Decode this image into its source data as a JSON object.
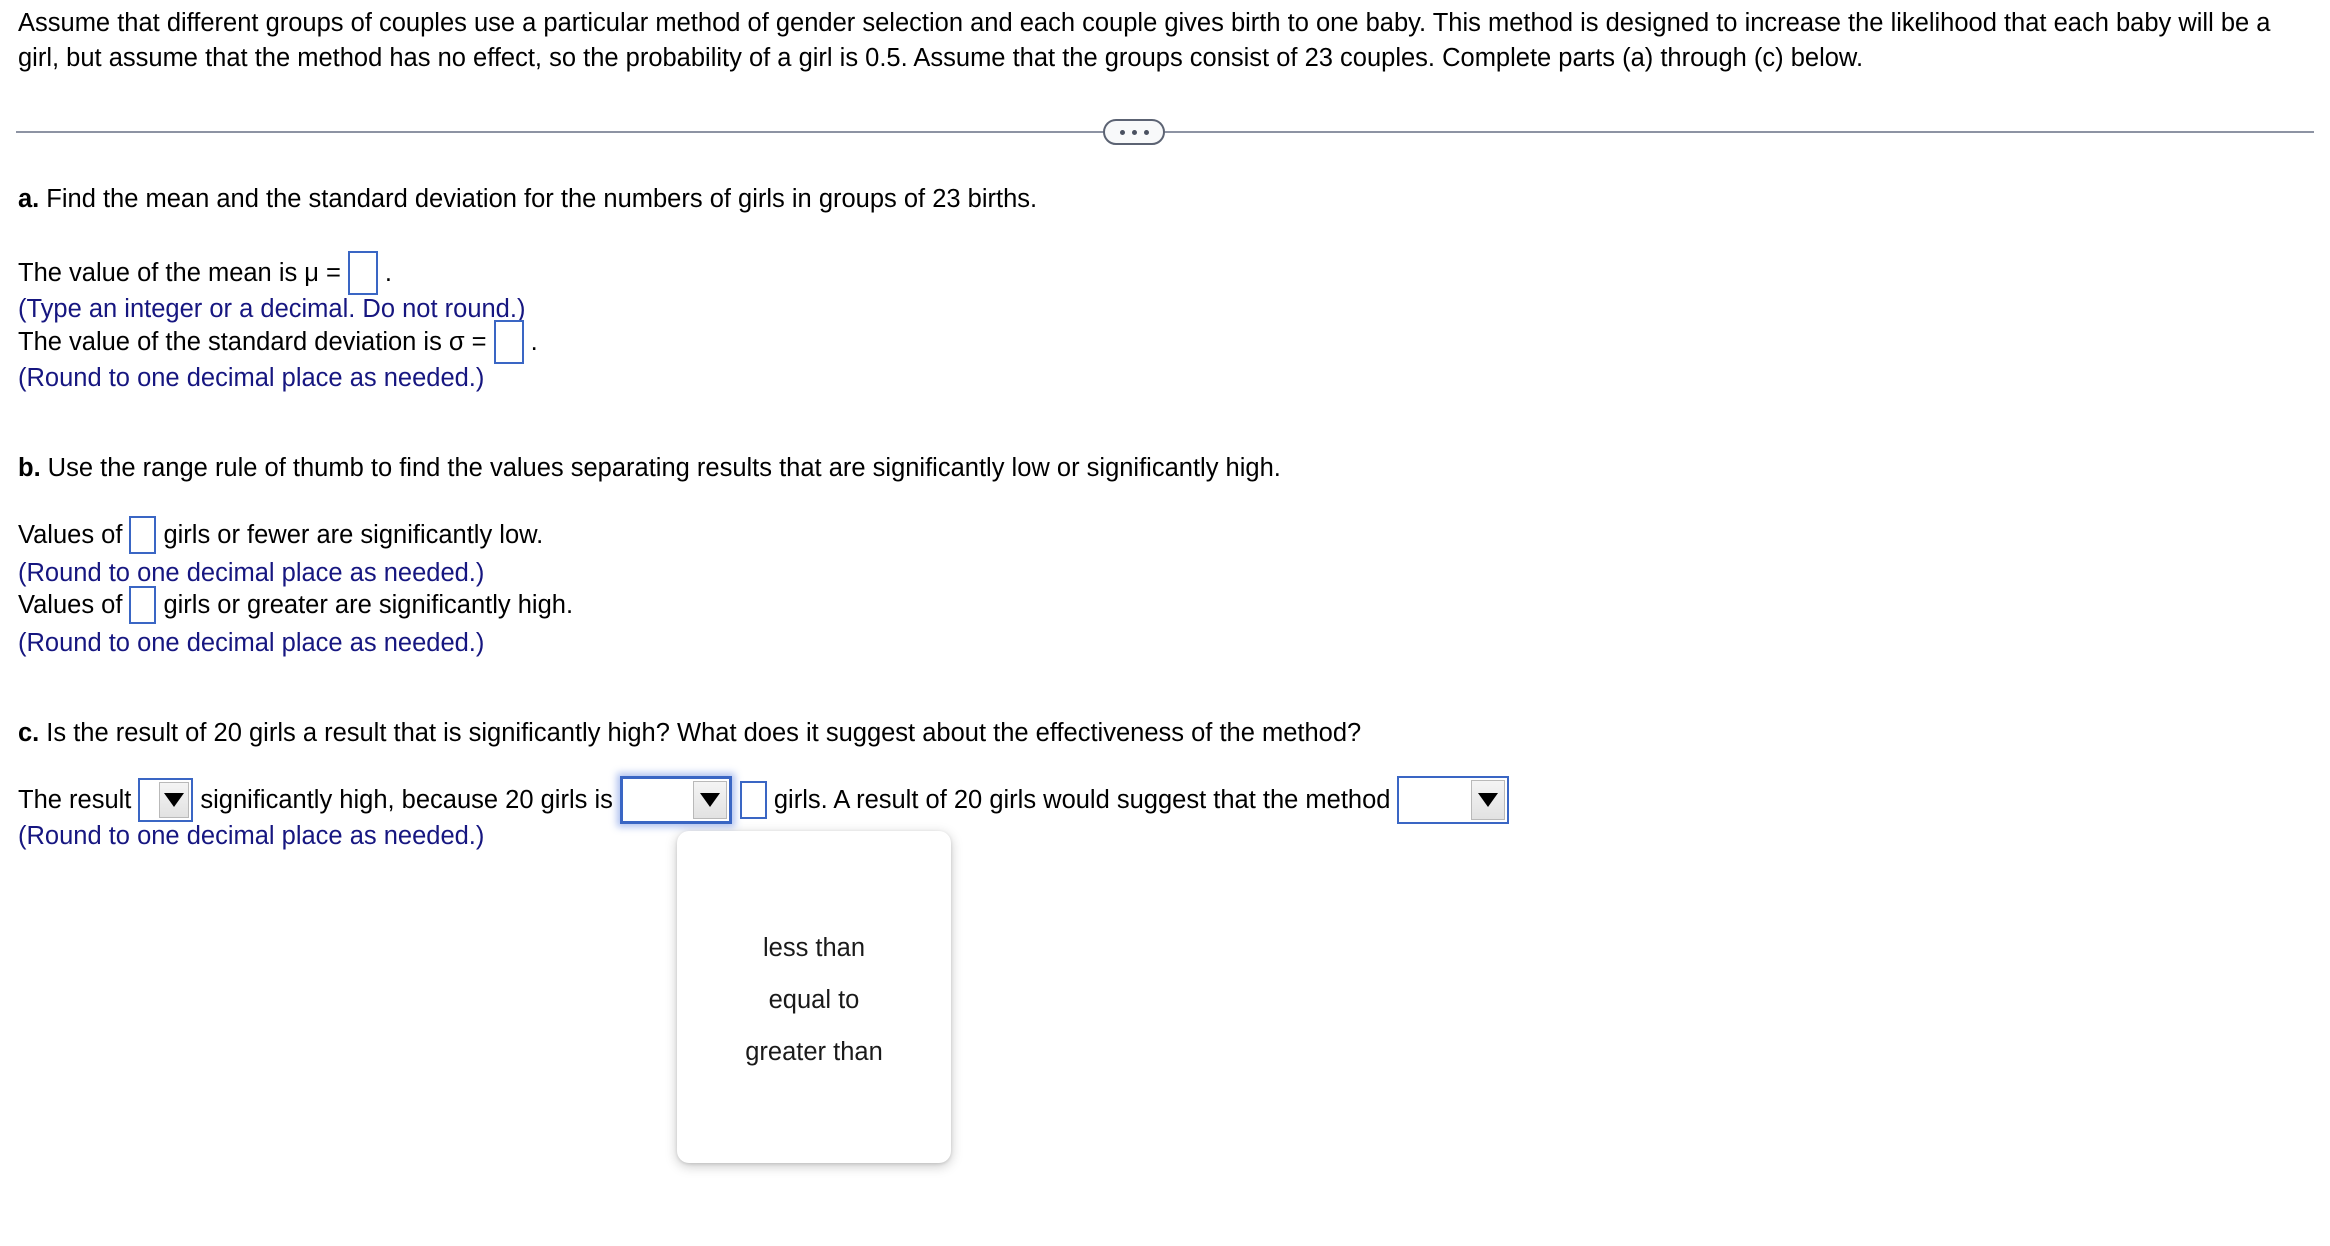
{
  "stem": {
    "text": "Assume that different groups of couples use a particular method of gender selection and each couple gives birth to one baby. This method is designed to increase the likelihood that each baby will be a girl, but assume that the method has no effect, so the probability of a girl is 0.5. Assume that the groups consist of 23 couples. Complete parts (a) through (c) below."
  },
  "divider": {
    "expand_icon": "ellipsis-icon"
  },
  "parts": {
    "a": {
      "label": "a.",
      "prompt": "Find the mean and the standard deviation for the numbers of girls in groups of 23 births.",
      "mean_prefix": "The value of the mean is",
      "mean_symbol": "μ =",
      "mean_value": "",
      "mean_suffix": ".",
      "mean_hint": "(Type an integer or a decimal. Do not round.)",
      "sd_prefix": "The value of the standard deviation is",
      "sd_symbol": "σ =",
      "sd_value": "",
      "sd_suffix": ".",
      "sd_hint": "(Round to one decimal place as needed.)"
    },
    "b": {
      "label": "b.",
      "prompt": "Use the range rule of thumb to find the values separating results that are significantly low or significantly high.",
      "low_prefix": "Values of",
      "low_value": "",
      "low_suffix": "girls or fewer are significantly low.",
      "low_hint": "(Round to one decimal place as needed.)",
      "high_prefix": "Values of",
      "high_value": "",
      "high_suffix": "girls or greater are significantly high.",
      "high_hint": "(Round to one decimal place as needed.)"
    },
    "c": {
      "label": "c.",
      "prompt": "Is the result of 20 girls a result that is significantly high? What does it suggest about the effectiveness of the method?",
      "segment1": "The result",
      "select1_value": "",
      "segment2": "significantly high, because 20 girls is",
      "select2_value": "",
      "input_value": "",
      "segment3": "girls. A result of 20 girls would suggest that the method",
      "select3_value": "",
      "hint": "(Round to one decimal place as needed.)"
    }
  },
  "dropdown": {
    "open": true,
    "options": [
      "less than",
      "equal to",
      "greater than"
    ]
  },
  "colors": {
    "hint_blue": "#161680",
    "field_border": "#3a66c4",
    "divider_gray": "#8d93a3",
    "focus_glow": "#4b74dc"
  }
}
